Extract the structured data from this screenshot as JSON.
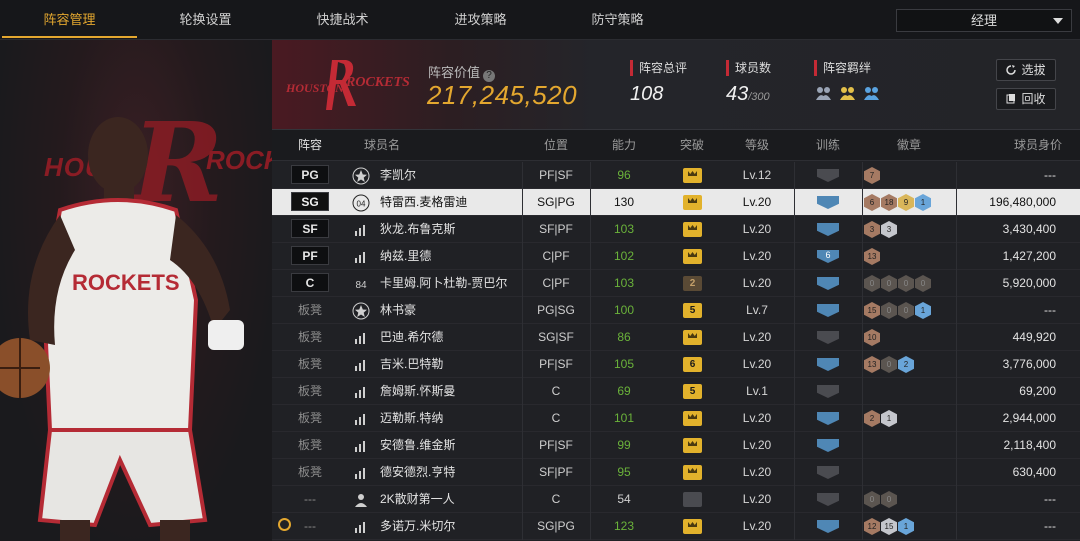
{
  "nav": {
    "tabs": [
      {
        "label": "阵容管理"
      },
      {
        "label": "轮换设置"
      },
      {
        "label": "快捷战术"
      },
      {
        "label": "进攻策略"
      },
      {
        "label": "防守策略"
      }
    ],
    "role_value": "经理"
  },
  "team": {
    "logo_text_left": "HOUSTON",
    "logo_text_right": "ROCKETS",
    "value_label": "阵容价值",
    "value": "217,245,520",
    "stats": {
      "rating_label": "阵容总评",
      "rating": "108",
      "count_label": "球员数",
      "count": "43",
      "count_max": "/300",
      "bond_label": "阵容羁绊"
    },
    "buttons": {
      "scout": "选拔",
      "recycle": "回收"
    }
  },
  "colors": {
    "accent": "#e3a72f",
    "red": "#c42a35",
    "green": "#6ab23a",
    "badge_blue": "#4f87b5"
  },
  "table": {
    "headers": [
      "阵容",
      "球员名",
      "位置",
      "能力",
      "突破",
      "等级",
      "训练",
      "徽章",
      "球员身价"
    ],
    "rows": [
      {
        "pos": "PG",
        "starter": true,
        "icon": "star-icon",
        "name": "李凯尔",
        "position": "PF|SF",
        "ability": "96",
        "ability_color": "green",
        "break": "crown",
        "level": "Lv.12",
        "train": "off",
        "badges": [
          "br:7"
        ],
        "worth": "---"
      },
      {
        "pos": "SG",
        "starter": true,
        "selected": true,
        "icon": "jersey-icon",
        "icon_text": "04",
        "name": "特雷西.麦格雷迪",
        "position": "SG|PG",
        "ability": "130",
        "ability_color": "white",
        "break": "crown",
        "level": "Lv.20",
        "train": "on",
        "badges": [
          "br:6",
          "br:18",
          "gd:9",
          "bl:1"
        ],
        "worth": "196,480,000"
      },
      {
        "pos": "SF",
        "starter": true,
        "icon": "bars-icon",
        "name": "狄龙.布鲁克斯",
        "position": "SF|PF",
        "ability": "103",
        "ability_color": "green",
        "break": "crown",
        "level": "Lv.20",
        "train": "on",
        "badges": [
          "br:3",
          "sv:3"
        ],
        "worth": "3,430,400"
      },
      {
        "pos": "PF",
        "starter": true,
        "icon": "bars-icon",
        "name": "纳兹.里德",
        "position": "C|PF",
        "ability": "102",
        "ability_color": "green",
        "break": "crown",
        "level": "Lv.20",
        "train": "on",
        "train_num": "6",
        "badges": [
          "br:13"
        ],
        "worth": "1,427,200"
      },
      {
        "pos": "C",
        "starter": true,
        "icon": "text-icon",
        "icon_text": "84",
        "name": "卡里姆.阿卜杜勒-贾巴尔",
        "position": "C|PF",
        "ability": "103",
        "ability_color": "green",
        "break": "dark:2",
        "level": "Lv.20",
        "train": "on",
        "badges": [
          "dk:0",
          "dk:0",
          "dk:0",
          "dk:0"
        ],
        "worth": "5,920,000"
      },
      {
        "pos": "板凳",
        "starter": false,
        "icon": "star-icon",
        "name": "林书豪",
        "position": "PG|SG",
        "ability": "100",
        "ability_color": "green",
        "break": "num:5",
        "level": "Lv.7",
        "train": "on",
        "badges": [
          "br:15",
          "dk:0",
          "dk:0",
          "bl:1"
        ],
        "worth": "---"
      },
      {
        "pos": "板凳",
        "starter": false,
        "icon": "bars-icon",
        "name": "巴迪.希尔德",
        "position": "SG|SF",
        "ability": "86",
        "ability_color": "green",
        "break": "crown",
        "level": "Lv.20",
        "train": "off",
        "badges": [
          "br:10"
        ],
        "worth": "449,920"
      },
      {
        "pos": "板凳",
        "starter": false,
        "icon": "bars-icon",
        "name": "吉米.巴特勒",
        "position": "PF|SF",
        "ability": "105",
        "ability_color": "green",
        "break": "num:6",
        "level": "Lv.20",
        "train": "on",
        "badges": [
          "br:13",
          "dk:0",
          "bl:2"
        ],
        "worth": "3,776,000"
      },
      {
        "pos": "板凳",
        "starter": false,
        "icon": "bars-icon",
        "name": "詹姆斯.怀斯曼",
        "position": "C",
        "ability": "69",
        "ability_color": "green",
        "break": "num:5",
        "level": "Lv.1",
        "train": "off",
        "badges": [],
        "worth": "69,200"
      },
      {
        "pos": "板凳",
        "starter": false,
        "icon": "bars-icon",
        "name": "迈勒斯.特纳",
        "position": "C",
        "ability": "101",
        "ability_color": "green",
        "break": "crown",
        "level": "Lv.20",
        "train": "on",
        "badges": [
          "br:2",
          "sv:1"
        ],
        "worth": "2,944,000"
      },
      {
        "pos": "板凳",
        "starter": false,
        "icon": "bars-icon",
        "name": "安德鲁.维金斯",
        "position": "PF|SF",
        "ability": "99",
        "ability_color": "green",
        "break": "crown",
        "level": "Lv.20",
        "train": "on",
        "badges": [],
        "worth": "2,118,400"
      },
      {
        "pos": "板凳",
        "starter": false,
        "icon": "bars-icon",
        "name": "德安德烈.亨特",
        "position": "SF|PF",
        "ability": "95",
        "ability_color": "green",
        "break": "crown",
        "level": "Lv.20",
        "train": "off",
        "badges": [],
        "worth": "630,400"
      },
      {
        "pos": "---",
        "starter": false,
        "icon": "person-icon",
        "name": "2K散财第一人",
        "position": "C",
        "ability": "54",
        "ability_color": "white",
        "break": "grey",
        "level": "Lv.20",
        "train": "off",
        "badges": [
          "dk:0",
          "dk:0"
        ],
        "worth": "---"
      },
      {
        "pos": "---",
        "starter": false,
        "icon": "bars-icon",
        "name": "多诺万.米切尔",
        "position": "SG|PG",
        "ability": "123",
        "ability_color": "green",
        "break": "crown",
        "level": "Lv.20",
        "train": "on",
        "badges": [
          "br:12",
          "sv:15",
          "bl:1"
        ],
        "worth": "---"
      }
    ]
  }
}
